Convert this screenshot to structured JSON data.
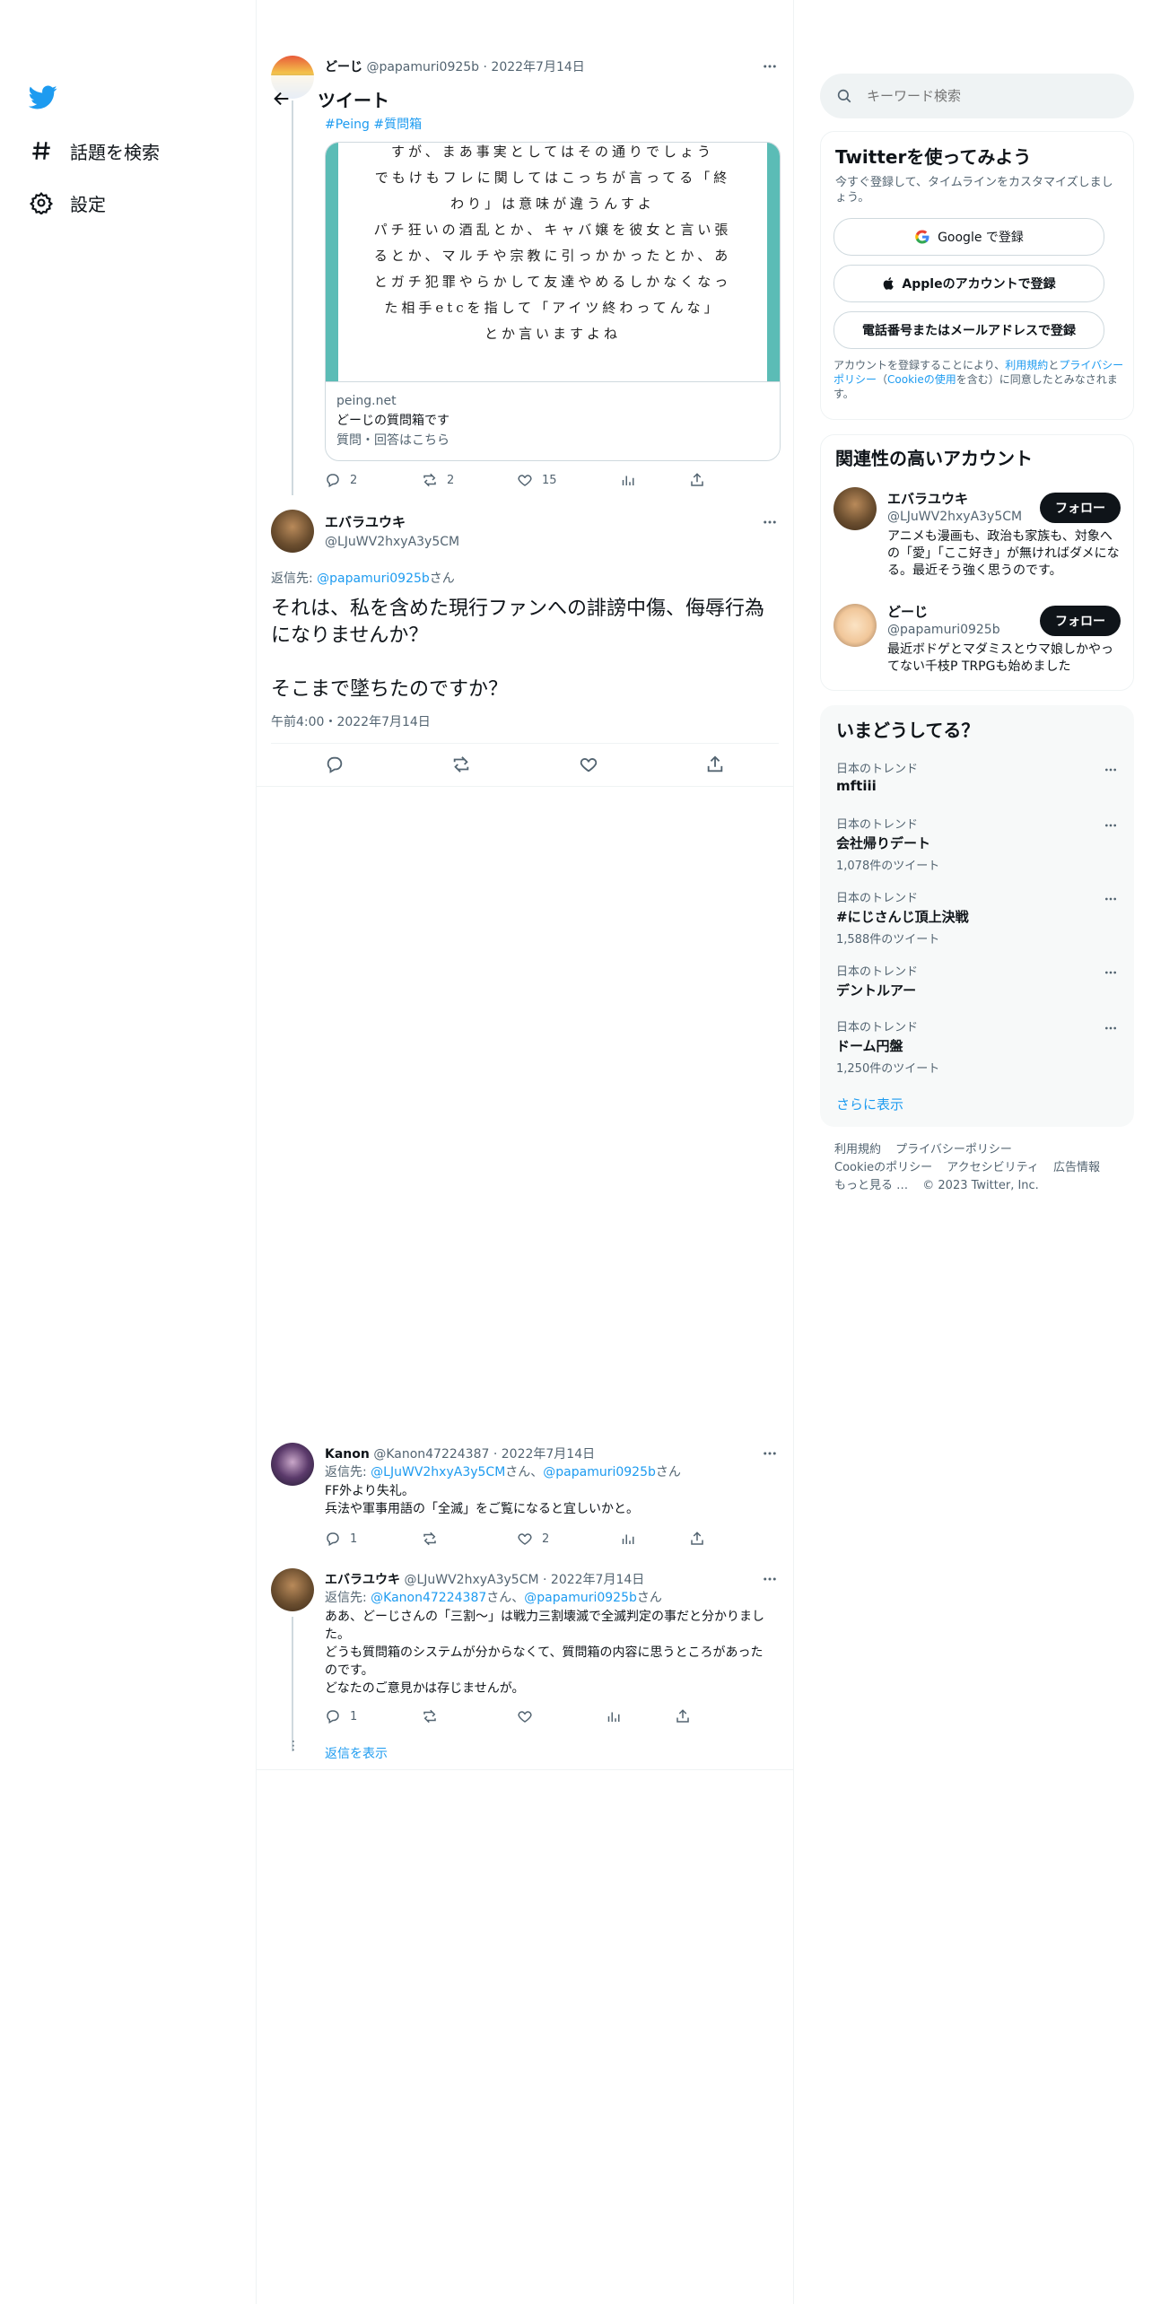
{
  "nav": {
    "explore_label": "話題を検索",
    "settings_label": "設定"
  },
  "header": {
    "title": "ツイート"
  },
  "parent_tweet": {
    "name": "どーじ",
    "handle": "@papamuri0925b",
    "date": "2022年7月14日",
    "hashtags": "#Peing #質問箱",
    "image_lines": [
      "すが、まあ事実としてはその通りでしょう",
      "でもけもフレに関してはこっちが言ってる「終",
      "わり」は意味が違うんすよ",
      "パチ狂いの酒乱とか、キャバ嬢を彼女と言い張",
      "るとか、マルチや宗教に引っかかったとか、あ",
      "とガチ犯罪やらかして友達やめるしかなくなっ",
      "た相手etcを指して「アイツ終わってんな」",
      "とか言いますよね"
    ],
    "card_domain": "peing.net",
    "card_title": "どーじの質問箱です",
    "card_desc": "質問・回答はこちら",
    "replies": "2",
    "retweets": "2",
    "likes": "15"
  },
  "main_tweet": {
    "name": "エバラユウキ",
    "handle": "@LJuWV2hxyA3y5CM",
    "reply_to_prefix": "返信先: ",
    "reply_to_user": "@papamuri0925b",
    "reply_to_suffix": "さん",
    "text_1": "それは、私を含めた現行ファンへの誹謗中傷、侮辱行為になりませんか？",
    "text_2": "そこまで墜ちたのですか？",
    "timestamp": "午前4:00・2022年7月14日"
  },
  "reply_1": {
    "name": "Kanon",
    "handle": "@Kanon47224387",
    "date": "2022年7月14日",
    "reply_to_prefix": "返信先: ",
    "reply_to_user1": "@LJuWV2hxyA3y5CM",
    "reply_to_mid": "さん、",
    "reply_to_user2": "@papamuri0925b",
    "reply_to_suffix": "さん",
    "text_1": "FF外より失礼。",
    "text_2": "兵法や軍事用語の「全滅」をご覧になると宜しいかと。",
    "replies": "1",
    "likes": "2"
  },
  "reply_2": {
    "name": "エバラユウキ",
    "handle": "@LJuWV2hxyA3y5CM",
    "date": "2022年7月14日",
    "reply_to_prefix": "返信先: ",
    "reply_to_user1": "@Kanon47224387",
    "reply_to_mid": "さん、",
    "reply_to_user2": "@papamuri0925b",
    "reply_to_suffix": "さん",
    "text_1": "ああ、どーじさんの「三割～」は戦力三割壊滅で全滅判定の事だと分かりました。",
    "text_2": "どうも質問箱のシステムが分からなくて、質問箱の内容に思うところがあったのです。",
    "text_3": "どなたのご意見かは存じませんが。",
    "replies": "1",
    "show_replies": "返信を表示"
  },
  "search": {
    "placeholder": "キーワード検索"
  },
  "signup": {
    "title": "Twitterを使ってみよう",
    "subtitle": "今すぐ登録して、タイムラインをカスタマイズしましょう。",
    "google": "Google で登録",
    "apple": "Appleのアカウントで登録",
    "phone": "電話番号またはメールアドレスで登録",
    "terms_prefix": "アカウントを登録することにより、",
    "terms_link1": "利用規約",
    "terms_and": "と",
    "terms_link2": "プライバシーポリシー",
    "terms_paren_open": "（",
    "terms_link3": "Cookieの使用",
    "terms_suffix": "を含む）に同意したとみなされます。"
  },
  "related": {
    "title": "関連性の高いアカウント",
    "follow_label": "フォロー",
    "accounts": [
      {
        "name": "エバラユウキ",
        "handle": "@LJuWV2hxyA3y5CM",
        "bio": "アニメも漫画も、政治も家族も、対象への「愛」「ここ好き」が無ければダメになる。最近そう強く思うのです。"
      },
      {
        "name": "どーじ",
        "handle": "@papamuri0925b",
        "bio": "最近ボドゲとマダミスとウマ娘しかやってない千枝P TRPGも始めました"
      }
    ]
  },
  "trends": {
    "title": "いまどうしてる？",
    "items": [
      {
        "category": "日本のトレンド",
        "name": "mftiii",
        "count": ""
      },
      {
        "category": "日本のトレンド",
        "name": "会社帰りデート",
        "count": "1,078件のツイート"
      },
      {
        "category": "日本のトレンド",
        "name": "#にじさんじ頂上決戦",
        "count": "1,588件のツイート"
      },
      {
        "category": "日本のトレンド",
        "name": "デントルアー",
        "count": ""
      },
      {
        "category": "日本のトレンド",
        "name": "ドーム円盤",
        "count": "1,250件のツイート"
      }
    ],
    "show_more": "さらに表示"
  },
  "footer": {
    "terms": "利用規約",
    "privacy": "プライバシーポリシー",
    "cookie": "Cookieのポリシー",
    "accessibility": "アクセシビリティ",
    "ads": "広告情報",
    "more": "もっと見る …",
    "copyright": "© 2023 Twitter, Inc."
  },
  "colors": {
    "accent": "#1d9bf0",
    "text": "#0f1419",
    "muted": "#536471",
    "border": "#eff3f4"
  },
  "icons": [
    "twitter-logo-icon",
    "hashtag-icon",
    "gear-icon",
    "back-arrow-icon",
    "search-icon",
    "reply-icon",
    "retweet-icon",
    "like-icon",
    "views-icon",
    "share-icon",
    "more-icon",
    "google-icon",
    "apple-icon"
  ]
}
